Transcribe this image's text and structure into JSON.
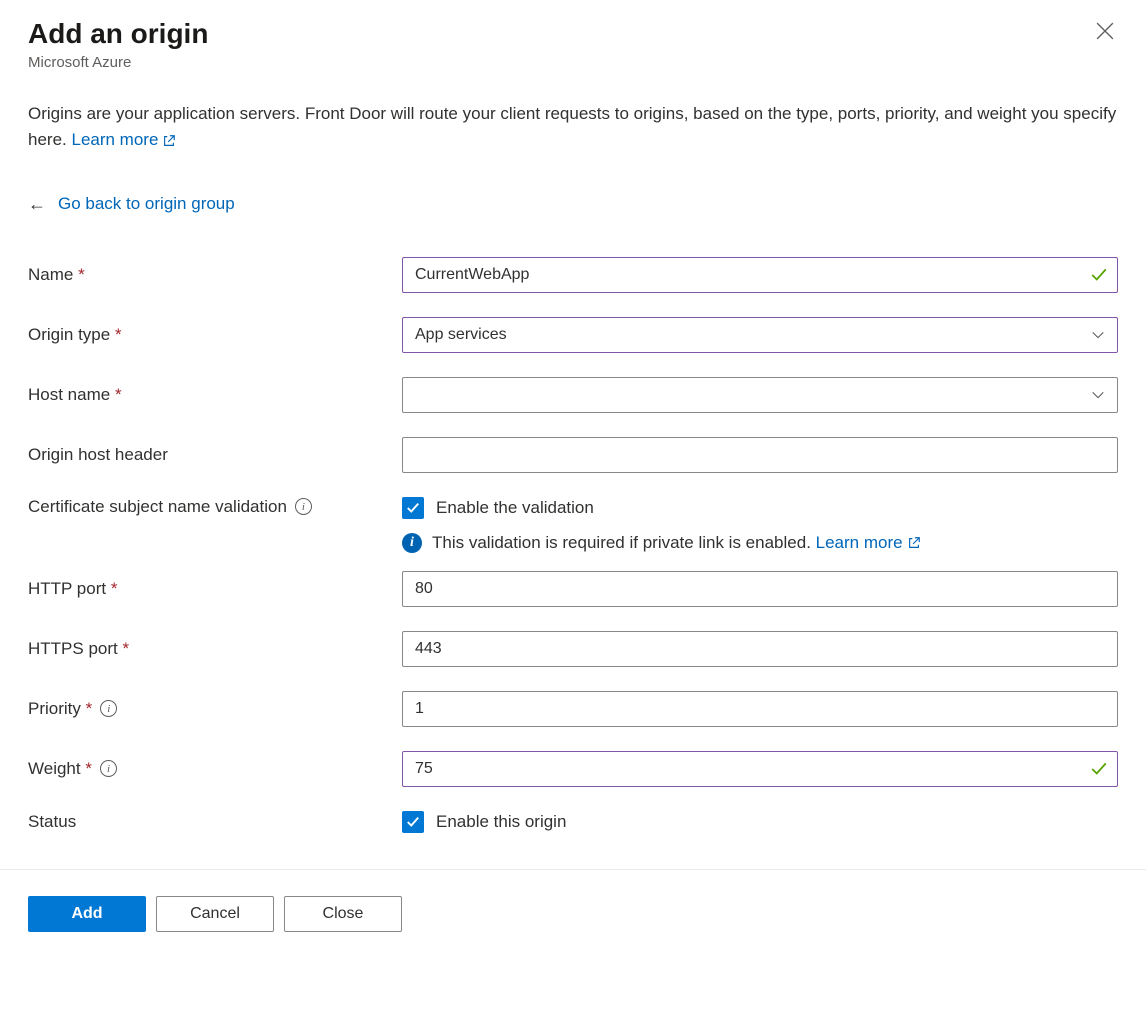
{
  "header": {
    "title": "Add an origin",
    "subtitle": "Microsoft Azure"
  },
  "intro": {
    "text": "Origins are your application servers. Front Door will route your client requests to origins, based on the type, ports, priority, and weight you specify here. ",
    "learn_more": "Learn more"
  },
  "backlink": "Go back to origin group",
  "fields": {
    "name": {
      "label": "Name",
      "value": "CurrentWebApp",
      "required": true
    },
    "origin_type": {
      "label": "Origin type",
      "value": "App services",
      "required": true
    },
    "host_name": {
      "label": "Host name",
      "value": "",
      "required": true
    },
    "origin_host_header": {
      "label": "Origin host header",
      "value": "",
      "required": false
    },
    "cert_validation": {
      "label": "Certificate subject name validation",
      "checkbox_label": "Enable the validation",
      "checked": true,
      "info_text": "This validation is required if private link is enabled. ",
      "info_link": "Learn more"
    },
    "http_port": {
      "label": "HTTP port",
      "value": "80",
      "required": true
    },
    "https_port": {
      "label": "HTTPS port",
      "value": "443",
      "required": true
    },
    "priority": {
      "label": "Priority",
      "value": "1",
      "required": true
    },
    "weight": {
      "label": "Weight",
      "value": "75",
      "required": true
    },
    "status": {
      "label": "Status",
      "checkbox_label": "Enable this origin",
      "checked": true
    }
  },
  "footer": {
    "add": "Add",
    "cancel": "Cancel",
    "close": "Close"
  }
}
